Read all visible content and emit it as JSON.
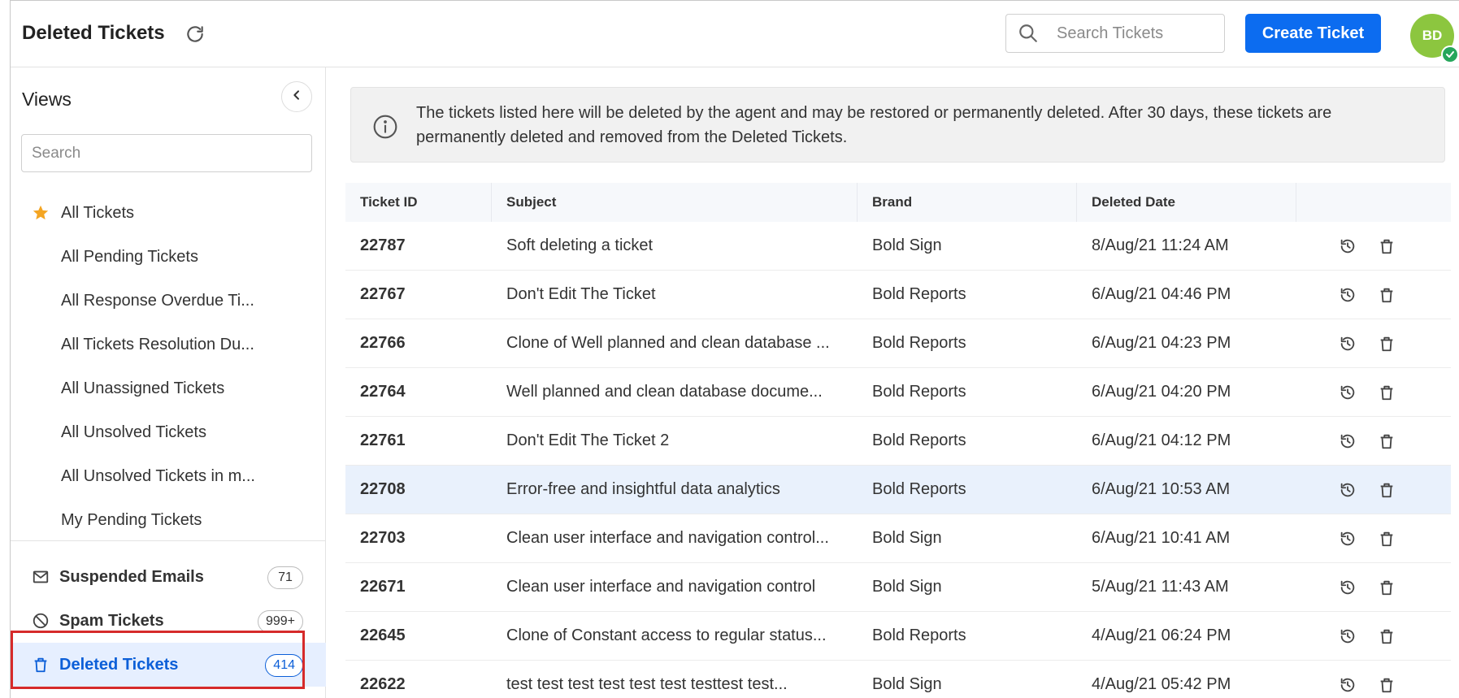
{
  "header": {
    "title": "Deleted Tickets",
    "search_placeholder": "Search Tickets",
    "create_label": "Create Ticket",
    "avatar_initials": "BD",
    "avatar_color": "#8cc63f",
    "accent": "#0c6cf0"
  },
  "sidebar": {
    "title": "Views",
    "search_placeholder": "Search",
    "views": [
      {
        "label": "All Tickets",
        "icon": "star-icon"
      },
      {
        "label": "All Pending Tickets"
      },
      {
        "label": "All Response Overdue Ti..."
      },
      {
        "label": "All Tickets Resolution Du..."
      },
      {
        "label": "All Unassigned Tickets"
      },
      {
        "label": "All Unsolved Tickets"
      },
      {
        "label": "All Unsolved Tickets in m..."
      },
      {
        "label": "My Pending Tickets"
      }
    ],
    "bottom": [
      {
        "label": "Suspended Emails",
        "count": "71",
        "icon": "envelope-icon"
      },
      {
        "label": "Spam Tickets",
        "count": "999+",
        "icon": "block-icon"
      },
      {
        "label": "Deleted Tickets",
        "count": "414",
        "icon": "trash-icon",
        "active": true
      }
    ]
  },
  "notice": {
    "text": "The tickets listed here will be deleted by the agent and may be restored or permanently deleted. After 30 days, these tickets are permanently deleted and removed from the Deleted Tickets."
  },
  "table": {
    "columns": [
      "Ticket ID",
      "Subject",
      "Brand",
      "Deleted Date",
      ""
    ],
    "rows": [
      {
        "id": "22787",
        "subject": "Soft deleting a ticket",
        "brand": "Bold Sign",
        "date": "8/Aug/21 11:24 AM"
      },
      {
        "id": "22767",
        "subject": "Don't Edit The Ticket",
        "brand": "Bold Reports",
        "date": "6/Aug/21 04:46 PM"
      },
      {
        "id": "22766",
        "subject": "Clone of Well planned and clean database ...",
        "brand": "Bold Reports",
        "date": "6/Aug/21 04:23 PM"
      },
      {
        "id": "22764",
        "subject": "Well planned and clean database docume...",
        "brand": "Bold Reports",
        "date": "6/Aug/21 04:20 PM"
      },
      {
        "id": "22761",
        "subject": "Don't Edit The Ticket 2",
        "brand": "Bold Reports",
        "date": "6/Aug/21 04:12 PM"
      },
      {
        "id": "22708",
        "subject": "Error-free and insightful data analytics",
        "brand": "Bold Reports",
        "date": "6/Aug/21 10:53 AM",
        "selected": true
      },
      {
        "id": "22703",
        "subject": "Clean user interface and navigation control...",
        "brand": "Bold Sign",
        "date": "6/Aug/21 10:41 AM"
      },
      {
        "id": "22671",
        "subject": "Clean user interface and navigation control",
        "brand": "Bold Sign",
        "date": "5/Aug/21 11:43 AM"
      },
      {
        "id": "22645",
        "subject": "Clone of Constant access to regular status...",
        "brand": "Bold Reports",
        "date": "4/Aug/21 06:24 PM"
      },
      {
        "id": "22622",
        "subject": "test test test test test test testtest test...",
        "brand": "Bold Sign",
        "date": "4/Aug/21 05:42 PM"
      }
    ],
    "row_actions": [
      "restore-icon",
      "delete-icon"
    ]
  }
}
